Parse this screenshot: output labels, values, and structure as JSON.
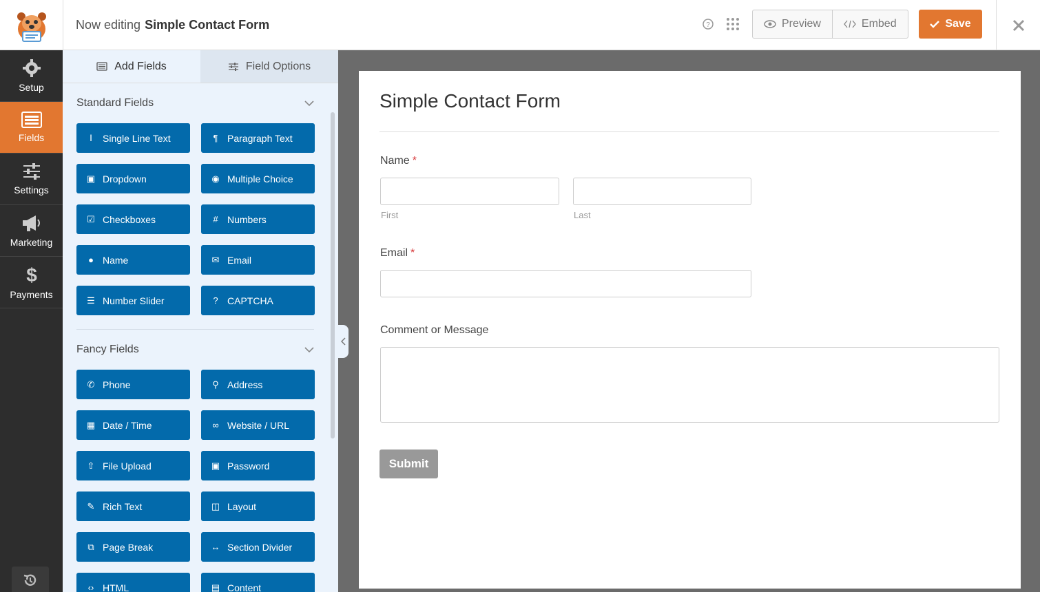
{
  "header": {
    "editing_prefix": "Now editing",
    "form_name": "Simple Contact Form",
    "preview_label": "Preview",
    "embed_label": "Embed",
    "save_label": "Save",
    "accent_color": "#e27730"
  },
  "nav": {
    "items": [
      {
        "label": "Setup",
        "icon": "gear-icon"
      },
      {
        "label": "Fields",
        "icon": "fields-list-icon",
        "active": true
      },
      {
        "label": "Settings",
        "icon": "sliders-icon"
      },
      {
        "label": "Marketing",
        "icon": "megaphone-icon"
      },
      {
        "label": "Payments",
        "icon": "dollar-icon"
      }
    ]
  },
  "panel": {
    "tabs": [
      {
        "label": "Add Fields",
        "icon": "list-icon"
      },
      {
        "label": "Field Options",
        "icon": "sliders-icon"
      }
    ],
    "standard_title": "Standard Fields",
    "standard_fields": [
      {
        "label": "Single Line Text",
        "icon": "text-icon"
      },
      {
        "label": "Paragraph Text",
        "icon": "paragraph-icon"
      },
      {
        "label": "Dropdown",
        "icon": "dropdown-icon"
      },
      {
        "label": "Multiple Choice",
        "icon": "radio-icon"
      },
      {
        "label": "Checkboxes",
        "icon": "checkbox-icon"
      },
      {
        "label": "Numbers",
        "icon": "hash-icon"
      },
      {
        "label": "Name",
        "icon": "user-icon"
      },
      {
        "label": "Email",
        "icon": "envelope-icon"
      },
      {
        "label": "Number Slider",
        "icon": "sliders-icon"
      },
      {
        "label": "CAPTCHA",
        "icon": "question-icon"
      }
    ],
    "fancy_title": "Fancy Fields",
    "fancy_fields": [
      {
        "label": "Phone",
        "icon": "phone-icon"
      },
      {
        "label": "Address",
        "icon": "map-pin-icon"
      },
      {
        "label": "Date / Time",
        "icon": "calendar-icon"
      },
      {
        "label": "Website / URL",
        "icon": "link-icon"
      },
      {
        "label": "File Upload",
        "icon": "upload-icon"
      },
      {
        "label": "Password",
        "icon": "lock-icon"
      },
      {
        "label": "Rich Text",
        "icon": "edit-icon"
      },
      {
        "label": "Layout",
        "icon": "columns-icon"
      },
      {
        "label": "Page Break",
        "icon": "copy-icon"
      },
      {
        "label": "Section Divider",
        "icon": "arrows-h-icon"
      },
      {
        "label": "HTML",
        "icon": "code-icon"
      },
      {
        "label": "Content",
        "icon": "file-icon"
      }
    ],
    "field_button_color": "#036aab"
  },
  "form": {
    "title": "Simple Contact Form",
    "name_label": "Name",
    "required_marker": "*",
    "first_sublabel": "First",
    "last_sublabel": "Last",
    "email_label": "Email",
    "message_label": "Comment or Message",
    "submit_label": "Submit"
  }
}
